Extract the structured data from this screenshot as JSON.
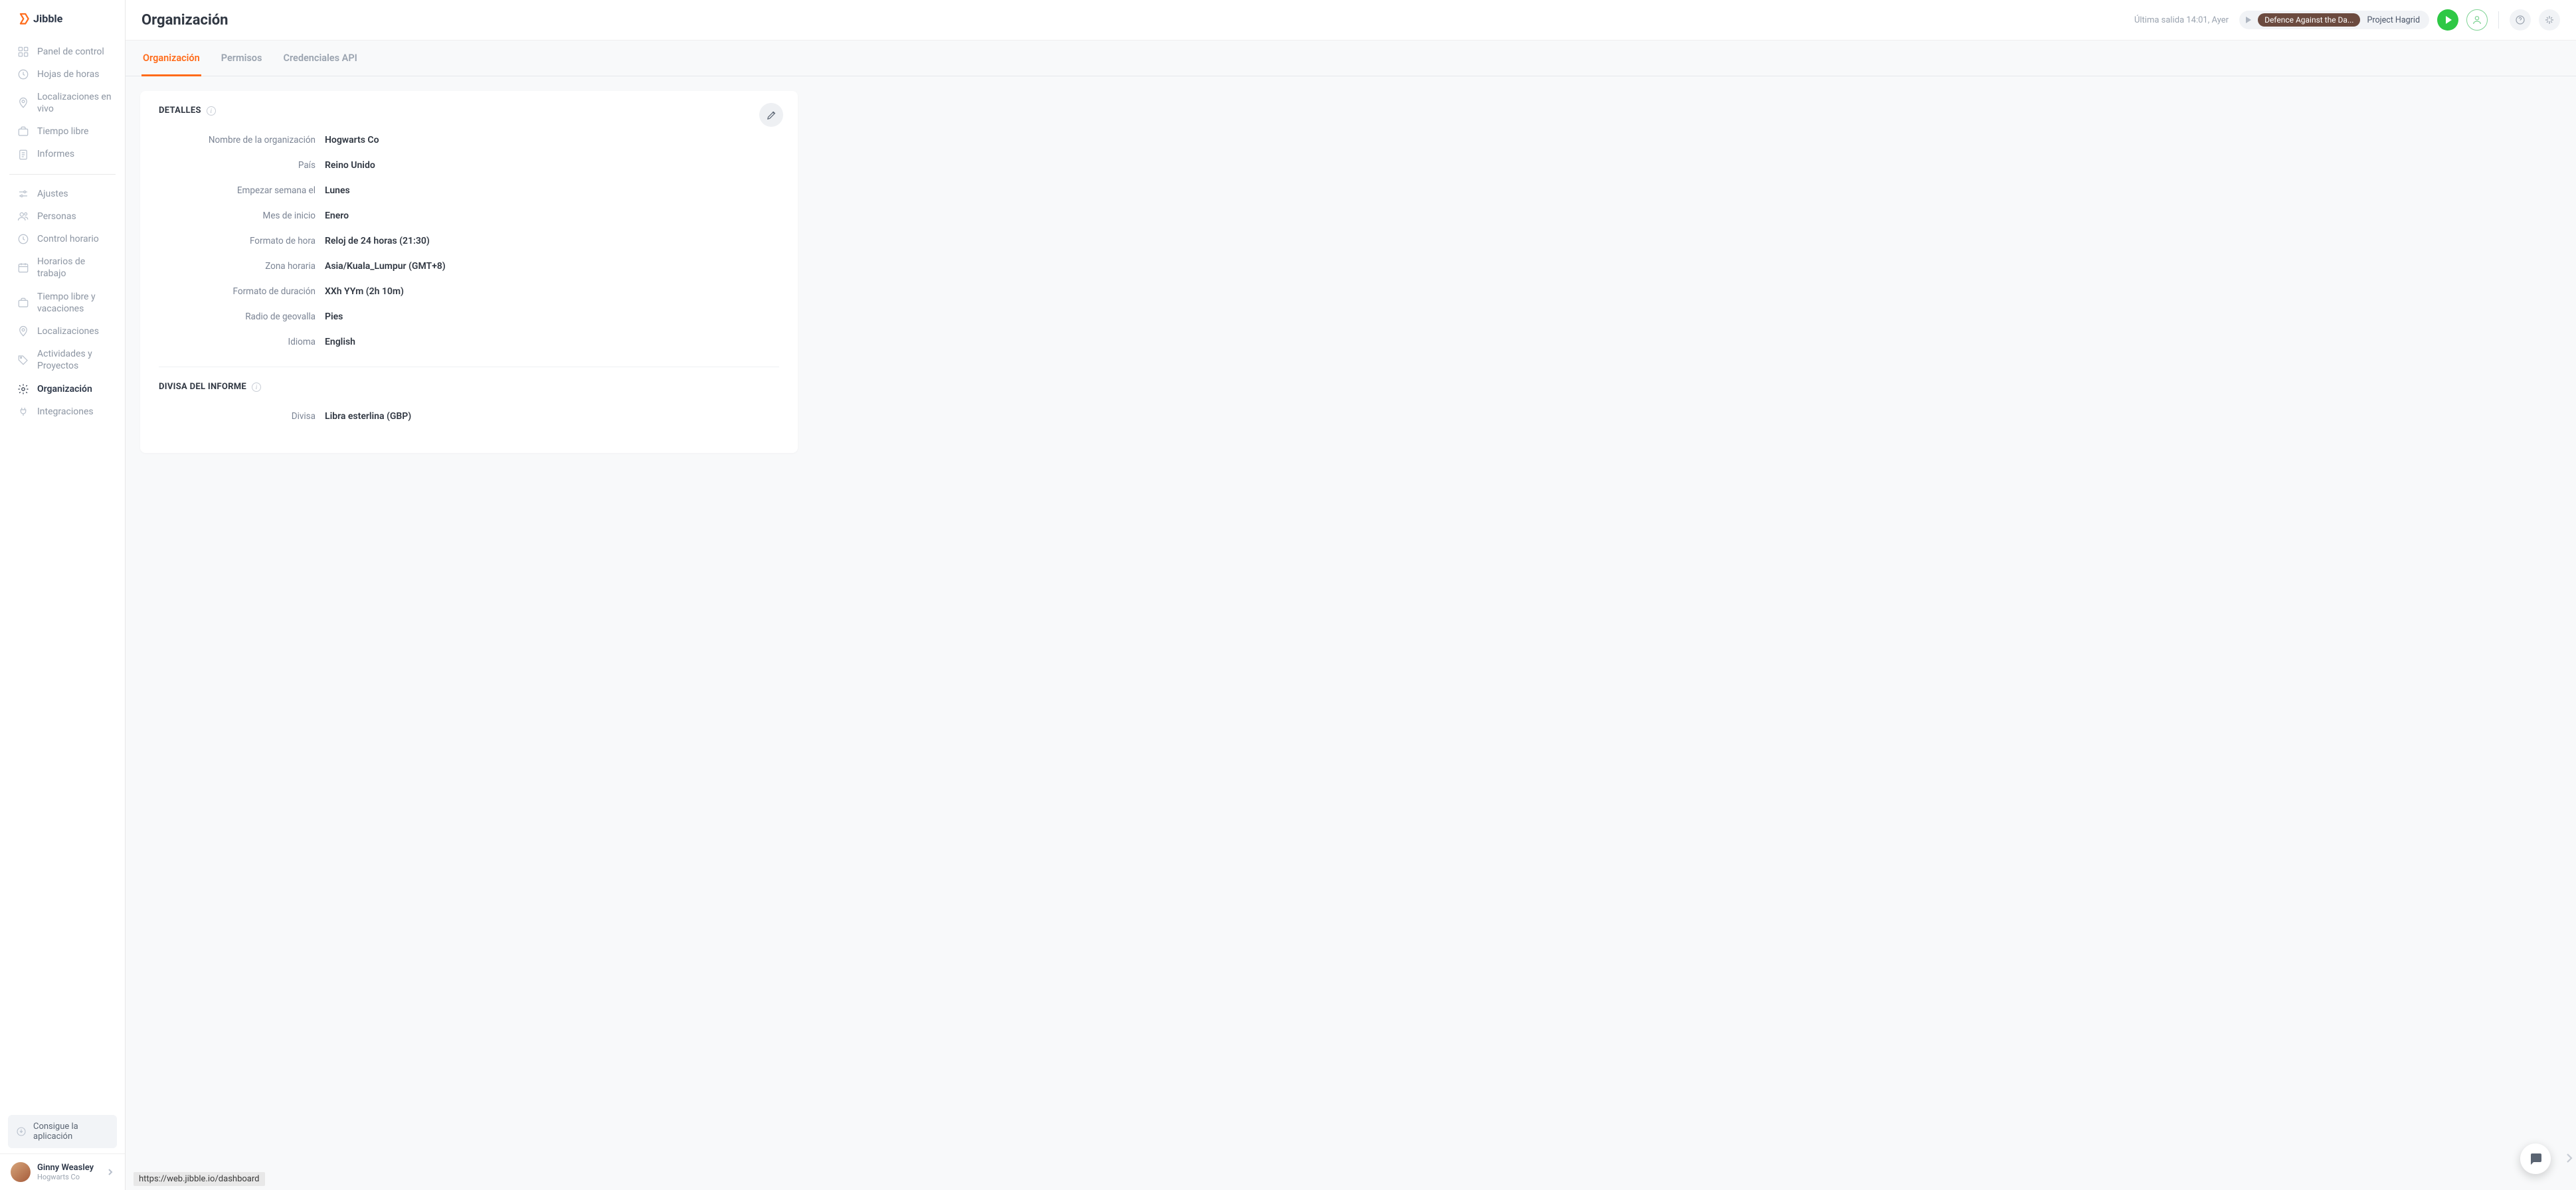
{
  "brand": "Jibble",
  "page_title": "Organización",
  "sidebar": {
    "groups": [
      {
        "items": [
          {
            "label": "Panel de control",
            "icon": "dashboard-icon"
          },
          {
            "label": "Hojas de horas",
            "icon": "clock-icon"
          },
          {
            "label": "Localizaciones en vivo",
            "icon": "pin-icon"
          },
          {
            "label": "Tiempo libre",
            "icon": "briefcase-icon"
          },
          {
            "label": "Informes",
            "icon": "report-icon"
          }
        ]
      },
      {
        "items": [
          {
            "label": "Ajustes",
            "icon": "sliders-icon"
          },
          {
            "label": "Personas",
            "icon": "people-icon"
          },
          {
            "label": "Control horario",
            "icon": "clock-icon"
          },
          {
            "label": "Horarios de trabajo",
            "icon": "schedule-icon"
          },
          {
            "label": "Tiempo libre y vacaciones",
            "icon": "briefcase-icon"
          },
          {
            "label": "Localizaciones",
            "icon": "pin-icon"
          },
          {
            "label": "Actividades y Proyectos",
            "icon": "tag-icon"
          },
          {
            "label": "Organización",
            "icon": "gear-icon",
            "active": true
          },
          {
            "label": "Integraciones",
            "icon": "plug-icon"
          }
        ]
      }
    ],
    "get_app": "Consigue la aplicación",
    "user": {
      "name": "Ginny Weasley",
      "org": "Hogwarts Co"
    }
  },
  "topbar": {
    "last_out": "Última salida 14:01, Ayer",
    "activity_chip": "Defence Against the Da...",
    "project_chip": "Project Hagrid"
  },
  "tabs": [
    {
      "label": "Organización",
      "active": true
    },
    {
      "label": "Permisos"
    },
    {
      "label": "Credenciales API"
    }
  ],
  "details": {
    "heading": "DETALLES",
    "rows": [
      {
        "label": "Nombre de la organización",
        "value": "Hogwarts Co"
      },
      {
        "label": "País",
        "value": "Reino Unido"
      },
      {
        "label": "Empezar semana el",
        "value": "Lunes"
      },
      {
        "label": "Mes de inicio",
        "value": "Enero"
      },
      {
        "label": "Formato de hora",
        "value": "Reloj de 24 horas (21:30)"
      },
      {
        "label": "Zona horaria",
        "value": "Asia/Kuala_Lumpur (GMT+8)"
      },
      {
        "label": "Formato de duración",
        "value": "XXh YYm (2h 10m)"
      },
      {
        "label": "Radio de geovalla",
        "value": "Pies"
      },
      {
        "label": "Idioma",
        "value": "English"
      }
    ]
  },
  "currency": {
    "heading": "DIVISA DEL INFORME",
    "rows": [
      {
        "label": "Divisa",
        "value": "Libra esterlina (GBP)"
      }
    ]
  },
  "status_url": "https://web.jibble.io/dashboard"
}
